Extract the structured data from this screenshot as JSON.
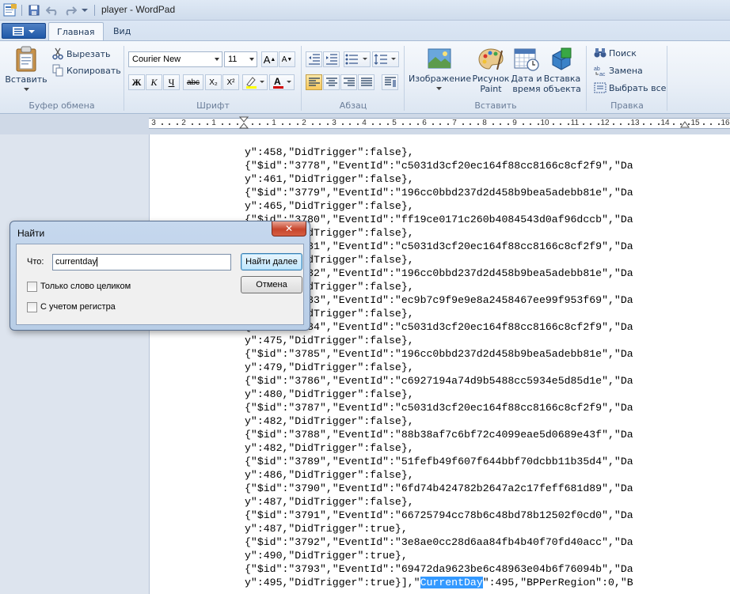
{
  "window": {
    "title": "player - WordPad"
  },
  "tabs": [
    {
      "label": "Главная"
    },
    {
      "label": "Вид"
    }
  ],
  "ribbon": {
    "clipboard": {
      "group_label": "Буфер обмена",
      "paste": "Вставить",
      "cut": "Вырезать",
      "copy": "Копировать"
    },
    "font": {
      "group_label": "Шрифт",
      "family": "Courier New",
      "size": "11",
      "bold": "Ж",
      "italic": "К",
      "underline": "Ч",
      "strike": "abc",
      "subscript": "X₂",
      "superscript": "X²"
    },
    "paragraph": {
      "group_label": "Абзац"
    },
    "insert": {
      "group_label": "Вставить",
      "image_line1": "Изображение",
      "paint_line1": "Рисунок",
      "paint_line2": "Paint",
      "datetime_line1": "Дата и",
      "datetime_line2": "время",
      "object_line1": "Вставка",
      "object_line2": "объекта"
    },
    "editing": {
      "group_label": "Правка",
      "find": "Поиск",
      "replace": "Замена",
      "select_all": "Выбрать все"
    }
  },
  "ruler": {
    "numbers": [
      "3",
      "2",
      "1",
      "1",
      "2",
      "3",
      "4",
      "5",
      "6",
      "7",
      "8",
      "9",
      "10",
      "11",
      "12",
      "13",
      "14",
      "15",
      "16"
    ]
  },
  "document": {
    "lines": [
      "y\":458,\"DidTrigger\":false},",
      "{\"$id\":\"3778\",\"EventId\":\"c5031d3cf20ec164f88cc8166c8cf2f9\",\"Da",
      "y\":461,\"DidTrigger\":false},",
      "{\"$id\":\"3779\",\"EventId\":\"196cc0bbd237d2d458b9bea5adebb81e\",\"Da",
      "y\":465,\"DidTrigger\":false},",
      "{\"$id\":\"3780\",\"EventId\":\"ff19ce0171c260b4084543d0af96dccb\",\"Da",
      "y\":468,\"DidTrigger\":false},",
      "{\"$id\":\"3781\",\"EventId\":\"c5031d3cf20ec164f88cc8166c8cf2f9\",\"Da",
      "y\":470,\"DidTrigger\":false},",
      "{\"$id\":\"3782\",\"EventId\":\"196cc0bbd237d2d458b9bea5adebb81e\",\"Da",
      "y\":472,\"DidTrigger\":false},",
      "{\"$id\":\"3783\",\"EventId\":\"ec9b7c9f9e9e8a2458467ee99f953f69\",\"Da",
      "y\":473,\"DidTrigger\":false},",
      "{\"$id\":\"3784\",\"EventId\":\"c5031d3cf20ec164f88cc8166c8cf2f9\",\"Da",
      "y\":475,\"DidTrigger\":false},",
      "{\"$id\":\"3785\",\"EventId\":\"196cc0bbd237d2d458b9bea5adebb81e\",\"Da",
      "y\":479,\"DidTrigger\":false},",
      "{\"$id\":\"3786\",\"EventId\":\"c6927194a74d9b5488cc5934e5d85d1e\",\"Da",
      "y\":480,\"DidTrigger\":false},",
      "{\"$id\":\"3787\",\"EventId\":\"c5031d3cf20ec164f88cc8166c8cf2f9\",\"Da",
      "y\":482,\"DidTrigger\":false},",
      "{\"$id\":\"3788\",\"EventId\":\"88b38af7c6bf72c4099eae5d0689e43f\",\"Da",
      "y\":482,\"DidTrigger\":false},",
      "{\"$id\":\"3789\",\"EventId\":\"51fefb49f607f644bbf70dcbb11b35d4\",\"Da",
      "y\":486,\"DidTrigger\":false},",
      "{\"$id\":\"3790\",\"EventId\":\"6fd74b424782b2647a2c17feff681d89\",\"Da",
      "y\":487,\"DidTrigger\":false},",
      "{\"$id\":\"3791\",\"EventId\":\"66725794cc78b6c48bd78b12502f0cd0\",\"Da",
      "y\":487,\"DidTrigger\":true},",
      "{\"$id\":\"3792\",\"EventId\":\"3e8ae0cc28d6aa84fb4b40f70fd40acc\",\"Da",
      "y\":490,\"DidTrigger\":true},",
      "{\"$id\":\"3793\",\"EventId\":\"69472da9623be6c48963e04b6f76094b\",\"Da"
    ],
    "last_line_before": "y\":495,\"DidTrigger\":true}],\"",
    "last_line_highlight": "CurrentDay",
    "last_line_after": "\":495,\"BPPerRegion\":0,\"B"
  },
  "find_dialog": {
    "title": "Найти",
    "what_label": "Что:",
    "what_value": "currentday",
    "find_next": "Найти далее",
    "cancel": "Отмена",
    "whole_word": "Только слово целиком",
    "match_case": "С учетом регистра"
  }
}
